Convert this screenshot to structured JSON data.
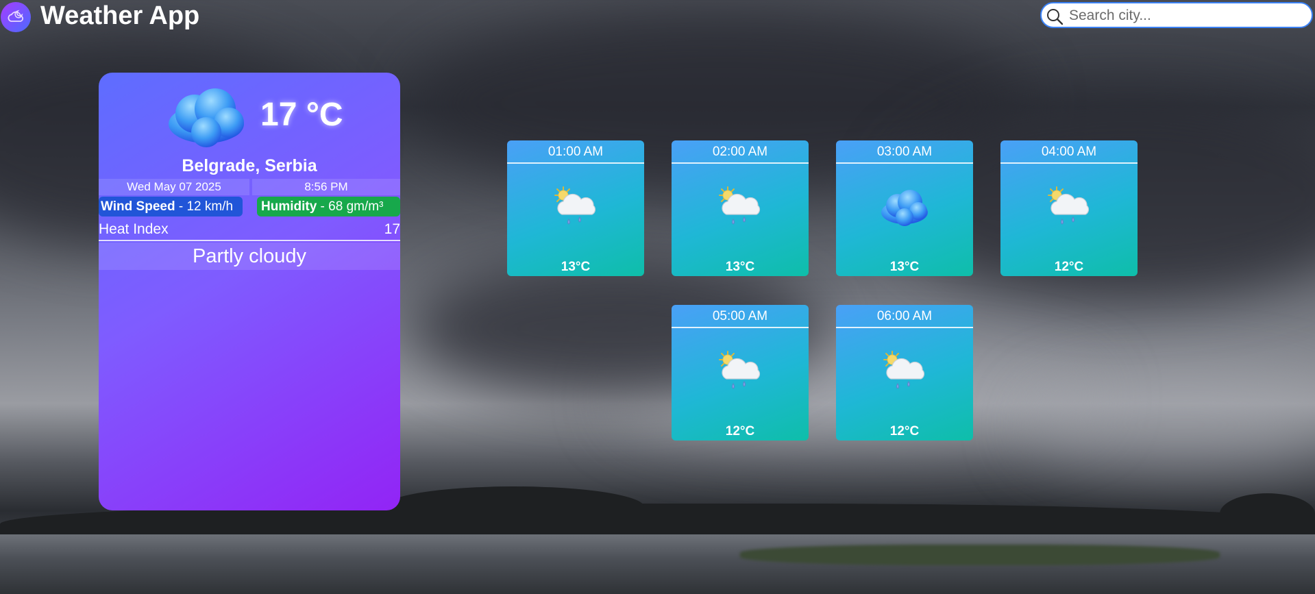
{
  "header": {
    "title": "Weather App",
    "logo_icon": "cloud-moon-icon"
  },
  "search": {
    "placeholder": "Search city...",
    "value": ""
  },
  "current": {
    "icon": "cloud-icon",
    "temperature": "17 °C",
    "location": "Belgrade, Serbia",
    "date": "Wed May 07 2025",
    "time": "8:56 PM",
    "wind_label": "Wind Speed",
    "wind_value": " - 12 km/h",
    "humidity_label": "Humidity",
    "humidity_value": " - 68 gm/m³",
    "heat_index_label": "Heat Index",
    "heat_index_value": "17",
    "condition": "Partly cloudy"
  },
  "hourly": [
    {
      "time": "01:00 AM",
      "temp": "13°C",
      "icon": "sun-cloud-rain-icon"
    },
    {
      "time": "02:00 AM",
      "temp": "13°C",
      "icon": "sun-cloud-rain-icon"
    },
    {
      "time": "03:00 AM",
      "temp": "13°C",
      "icon": "cloud-icon"
    },
    {
      "time": "04:00 AM",
      "temp": "12°C",
      "icon": "sun-cloud-rain-icon"
    },
    {
      "time": "05:00 AM",
      "temp": "12°C",
      "icon": "sun-cloud-rain-icon"
    },
    {
      "time": "06:00 AM",
      "temp": "12°C",
      "icon": "sun-cloud-rain-icon"
    }
  ],
  "colors": {
    "card_start": "#5e6dff",
    "card_end": "#9224f5",
    "tile_start": "#4aa0f7",
    "tile_end": "#0ebea9",
    "wind_pill": "#2155d8",
    "humidity_pill": "#17a84b",
    "search_border": "#3b82f6"
  }
}
